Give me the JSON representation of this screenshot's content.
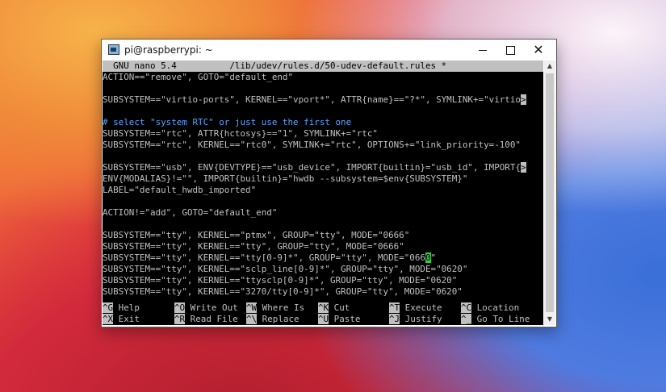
{
  "window": {
    "title": "pi@raspberrypi: ~",
    "minimize_glyph": "",
    "maximize_glyph": "",
    "close_glyph": "✕"
  },
  "nano": {
    "header": "  GNU nano 5.4          /lib/udev/rules.d/50-udev-default.rules *",
    "lines": [
      "ACTION==\"remove\", GOTO=\"default_end\"",
      "",
      "SUBSYSTEM==\"virtio-ports\", KERNEL==\"vport*\", ATTR{name}==\"?*\", SYMLINK+=\"virtio",
      "",
      "# select \"system RTC\" or just use the first one",
      "SUBSYSTEM==\"rtc\", ATTR{hctosys}==\"1\", SYMLINK+=\"rtc\"",
      "SUBSYSTEM==\"rtc\", KERNEL==\"rtc0\", SYMLINK+=\"rtc\", OPTIONS+=\"link_priority=-100\"",
      "",
      "SUBSYSTEM==\"usb\", ENV{DEVTYPE}==\"usb_device\", IMPORT{builtin}=\"usb_id\", IMPORT{",
      "ENV{MODALIAS}!=\"\", IMPORT{builtin}=\"hwdb --subsystem=$env{SUBSYSTEM}\"",
      "LABEL=\"default_hwdb_imported\"",
      "",
      "ACTION!=\"add\", GOTO=\"default_end\"",
      "",
      "SUBSYSTEM==\"tty\", KERNEL==\"ptmx\", GROUP=\"tty\", MODE=\"0666\"",
      "SUBSYSTEM==\"tty\", KERNEL==\"tty\", GROUP=\"tty\", MODE=\"0666\"",
      "SUBSYSTEM==\"tty\", KERNEL==\"tty[0-9]*\", GROUP=\"tty\", MODE=\"066",
      "SUBSYSTEM==\"tty\", KERNEL==\"sclp_line[0-9]*\", GROUP=\"tty\", MODE=\"0620\"",
      "SUBSYSTEM==\"tty\", KERNEL==\"ttysclp[0-9]*\", GROUP=\"tty\", MODE=\"0620\"",
      "SUBSYSTEM==\"tty\", KERNEL==\"3270/tty[0-9]*\", GROUP=\"tty\", MODE=\"0620\""
    ],
    "overflow_marker": ">",
    "cursor_char": "0",
    "after_cursor": "\"",
    "shortcuts_row1": [
      {
        "key": "^G",
        "label": " Help"
      },
      {
        "key": "^O",
        "label": " Write Out"
      },
      {
        "key": "^W",
        "label": " Where Is"
      },
      {
        "key": "^K",
        "label": " Cut"
      },
      {
        "key": "^T",
        "label": " Execute"
      },
      {
        "key": "^C",
        "label": " Location"
      }
    ],
    "shortcuts_row2": [
      {
        "key": "^X",
        "label": " Exit"
      },
      {
        "key": "^R",
        "label": " Read File"
      },
      {
        "key": "^\\",
        "label": " Replace"
      },
      {
        "key": "^U",
        "label": " Paste"
      },
      {
        "key": "^J",
        "label": " Justify"
      },
      {
        "key": "^_",
        "label": " Go To Line"
      }
    ]
  },
  "colors": {
    "comment": "#5aa6ff",
    "cursor": "#2ecc40",
    "terminal_bg": "#000000",
    "terminal_fg": "#c0c0c0"
  },
  "icons": [
    "putty-app-icon",
    "minimize-icon",
    "maximize-icon",
    "close-icon",
    "scroll-up-icon",
    "scroll-down-icon"
  ]
}
